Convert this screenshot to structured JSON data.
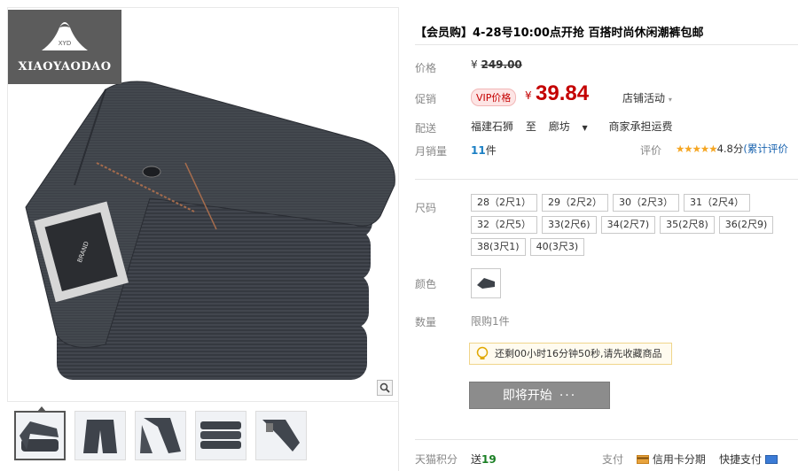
{
  "gallery": {
    "brand": "XIAOYAODAO",
    "brand_mark": "XYD",
    "zoom_icon": "magnifier-icon",
    "thumb_count": 5
  },
  "product": {
    "title": "【会员购】4-28号10:00点开抢 百搭时尚休闲潮裤包邮"
  },
  "price": {
    "label": "价格",
    "currency": "¥",
    "original": "249.00"
  },
  "promo": {
    "label": "促销",
    "vip_badge": "VIP价格",
    "currency": "¥",
    "price": "39.84",
    "shop_activity": "店铺活动"
  },
  "shipping": {
    "label": "配送",
    "from": "福建石狮",
    "to_word": "至",
    "to": "廊坊",
    "fee": "商家承担运费"
  },
  "sales": {
    "label": "月销量",
    "count": "11",
    "unit": "件"
  },
  "review": {
    "label": "评价",
    "stars": "★★★★★",
    "score": "4.8分",
    "link": "(累计评价"
  },
  "size": {
    "label": "尺码",
    "options": [
      "28（2尺1）",
      "29（2尺2）",
      "30（2尺3）",
      "31（2尺4）",
      "32（2尺5）",
      "33(2尺6)",
      "34(2尺7)",
      "35(2尺8)",
      "36(2尺9)",
      "38(3尺1)",
      "40(3尺3)"
    ]
  },
  "color": {
    "label": "颜色"
  },
  "quantity": {
    "label": "数量",
    "limit": "限购1件"
  },
  "countdown": {
    "text": "还剩00小时16分钟50秒,请先收藏商品"
  },
  "buy_button": {
    "label": "即将开始",
    "dots": "···"
  },
  "footer": {
    "points_label": "天猫积分",
    "points_prefix": "送",
    "points": "19",
    "pay_label": "支付",
    "card_pay": "信用卡分期",
    "quick_pay": "快捷支付"
  },
  "colors": {
    "price_red": "#c40000",
    "link_blue": "#1a7fc4",
    "button_gray": "#8c8c8c"
  }
}
